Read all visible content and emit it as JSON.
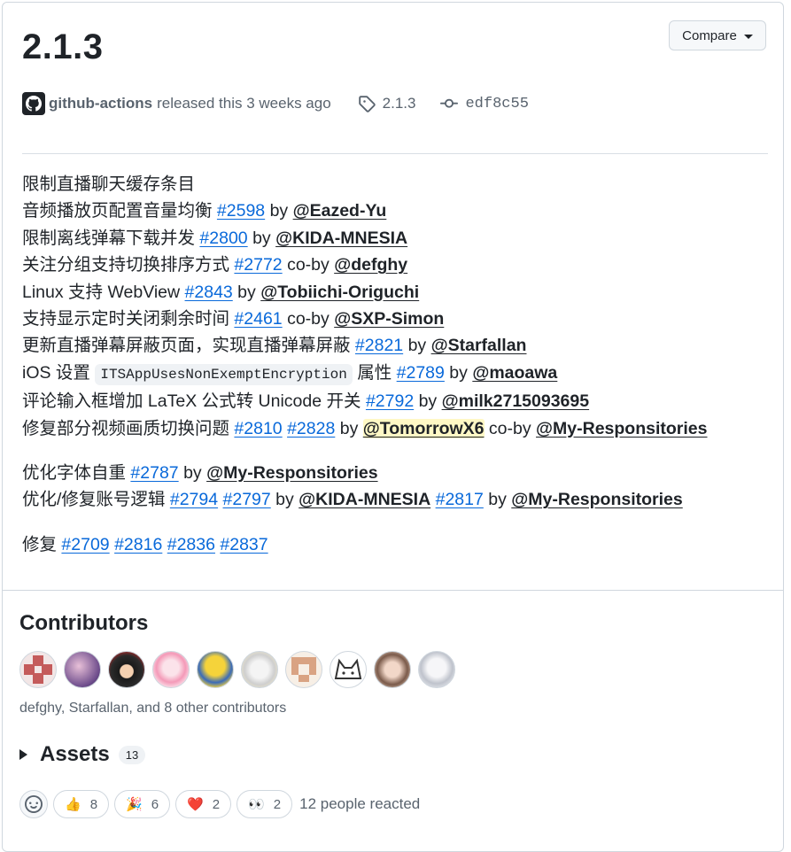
{
  "release": {
    "title": "2.1.3",
    "compare_label": "Compare",
    "actor": "github-actions",
    "released_text": "released this 3 weeks ago",
    "tag": "2.1.3",
    "commit": "edf8c55"
  },
  "notes": {
    "l1": "限制直播聊天缓存条目",
    "l2": {
      "text": "音频播放页配置音量均衡 ",
      "issue": "#2598",
      "by": " by ",
      "user": "@Eazed-Yu"
    },
    "l3": {
      "text": "限制离线弹幕下载并发 ",
      "issue": "#2800",
      "by": " by ",
      "user": "@KIDA-MNESIA"
    },
    "l4": {
      "text": "关注分组支持切换排序方式 ",
      "issue": "#2772",
      "by": " co-by ",
      "user": "@defghy"
    },
    "l5": {
      "text": "Linux 支持 WebView ",
      "issue": "#2843",
      "by": " by ",
      "user": "@Tobiichi-Origuchi"
    },
    "l6": {
      "text": "支持显示定时关闭剩余时间 ",
      "issue": "#2461",
      "by": " co-by ",
      "user": "@SXP-Simon"
    },
    "l7": {
      "text": "更新直播弹幕屏蔽页面，实现直播弹幕屏蔽 ",
      "issue": "#2821",
      "by": " by ",
      "user": "@Starfallan"
    },
    "l8": {
      "text": "iOS 设置 ",
      "code": "ITSAppUsesNonExemptEncryption",
      "after": " 属性 ",
      "issue": "#2789",
      "by": " by ",
      "user": "@maoawa"
    },
    "l9": {
      "text": "评论输入框增加 LaTeX 公式转 Unicode 开关 ",
      "issue": "#2792",
      "by": " by ",
      "user": "@milk2715093695"
    },
    "l10": {
      "text": "修复部分视频画质切换问题 ",
      "issue1": "#2810",
      "issue2": "#2828",
      "by": " by ",
      "user1": "@TomorrowX6",
      "coby": " co-by ",
      "user2": "@My-Responsitories"
    },
    "l11": {
      "text": "优化字体自重 ",
      "issue": "#2787",
      "by": " by ",
      "user": "@My-Responsitories"
    },
    "l12": {
      "text": "优化/修复账号逻辑 ",
      "issue1": "#2794",
      "issue2": "#2797",
      "by": " by ",
      "user1": "@KIDA-MNESIA",
      "issue3": "#2817",
      "by2": " by ",
      "user2": "@My-Responsitories"
    },
    "l13": {
      "text": "修复 ",
      "issues": [
        "#2709",
        "#2816",
        "#2836",
        "#2837"
      ]
    }
  },
  "contributors": {
    "title": "Contributors",
    "summary": "defghy, Starfallan, and 8 other contributors"
  },
  "assets": {
    "title": "Assets",
    "count": "13"
  },
  "reactions": {
    "items": [
      {
        "emoji": "👍",
        "count": "8"
      },
      {
        "emoji": "🎉",
        "count": "6"
      },
      {
        "emoji": "❤️",
        "count": "2"
      },
      {
        "emoji": "👀",
        "count": "2"
      }
    ],
    "summary": "12 people reacted"
  }
}
